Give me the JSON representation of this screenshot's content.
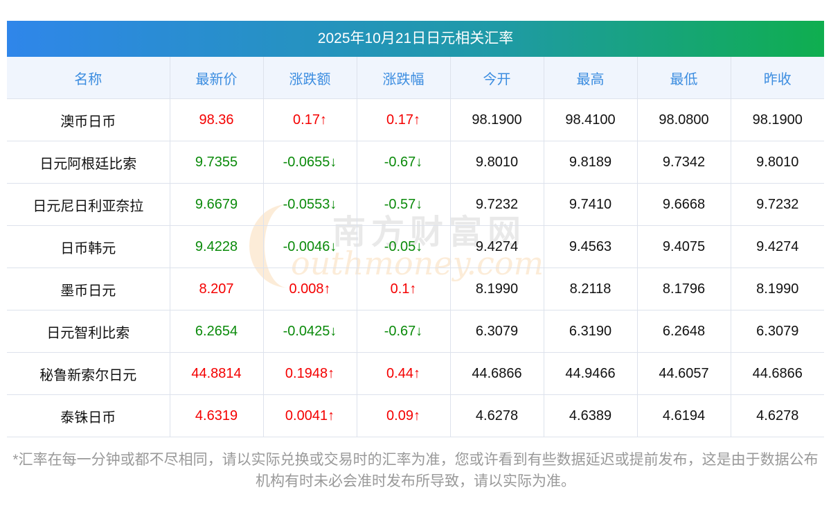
{
  "title": "2025年10月21日日元相关汇率",
  "headers": [
    "名称",
    "最新价",
    "涨跌额",
    "涨跌幅",
    "今开",
    "最高",
    "最低",
    "昨收"
  ],
  "rows": [
    {
      "dir": "up",
      "cells": [
        "澳币日币",
        "98.36",
        "0.17↑",
        "0.17↑",
        "98.1900",
        "98.4100",
        "98.0800",
        "98.1900"
      ]
    },
    {
      "dir": "down",
      "cells": [
        "日元阿根廷比索",
        "9.7355",
        "-0.0655↓",
        "-0.67↓",
        "9.8010",
        "9.8189",
        "9.7342",
        "9.8010"
      ]
    },
    {
      "dir": "down",
      "cells": [
        "日元尼日利亚奈拉",
        "9.6679",
        "-0.0553↓",
        "-0.57↓",
        "9.7232",
        "9.7410",
        "9.6668",
        "9.7232"
      ]
    },
    {
      "dir": "down",
      "cells": [
        "日币韩元",
        "9.4228",
        "-0.0046↓",
        "-0.05↓",
        "9.4274",
        "9.4563",
        "9.4075",
        "9.4274"
      ]
    },
    {
      "dir": "up",
      "cells": [
        "墨币日元",
        "8.207",
        "0.008↑",
        "0.1↑",
        "8.1990",
        "8.2118",
        "8.1796",
        "8.1990"
      ]
    },
    {
      "dir": "down",
      "cells": [
        "日元智利比索",
        "6.2654",
        "-0.0425↓",
        "-0.67↓",
        "6.3079",
        "6.3190",
        "6.2648",
        "6.3079"
      ]
    },
    {
      "dir": "up",
      "cells": [
        "秘鲁新索尔日元",
        "44.8814",
        "0.1948↑",
        "0.44↑",
        "44.6866",
        "44.9466",
        "44.6057",
        "44.6866"
      ]
    },
    {
      "dir": "up",
      "cells": [
        "泰铢日币",
        "4.6319",
        "0.0041↑",
        "0.09↑",
        "4.6278",
        "4.6389",
        "4.6194",
        "4.6278"
      ]
    }
  ],
  "note": "*汇率在每一分钟或都不尽相同，请以实际兑换或交易时的汇率为准，您或许看到有些数据延迟或提前发布，这是由于数据公布机构有时未必会准时发布所导致，请以实际为准。",
  "watermark": {
    "cn": "南方财富网",
    "en": "outhmoney.com"
  },
  "colors": {
    "up": "#f40000",
    "down": "#0a8a0a",
    "header_text": "#3c8de0"
  }
}
